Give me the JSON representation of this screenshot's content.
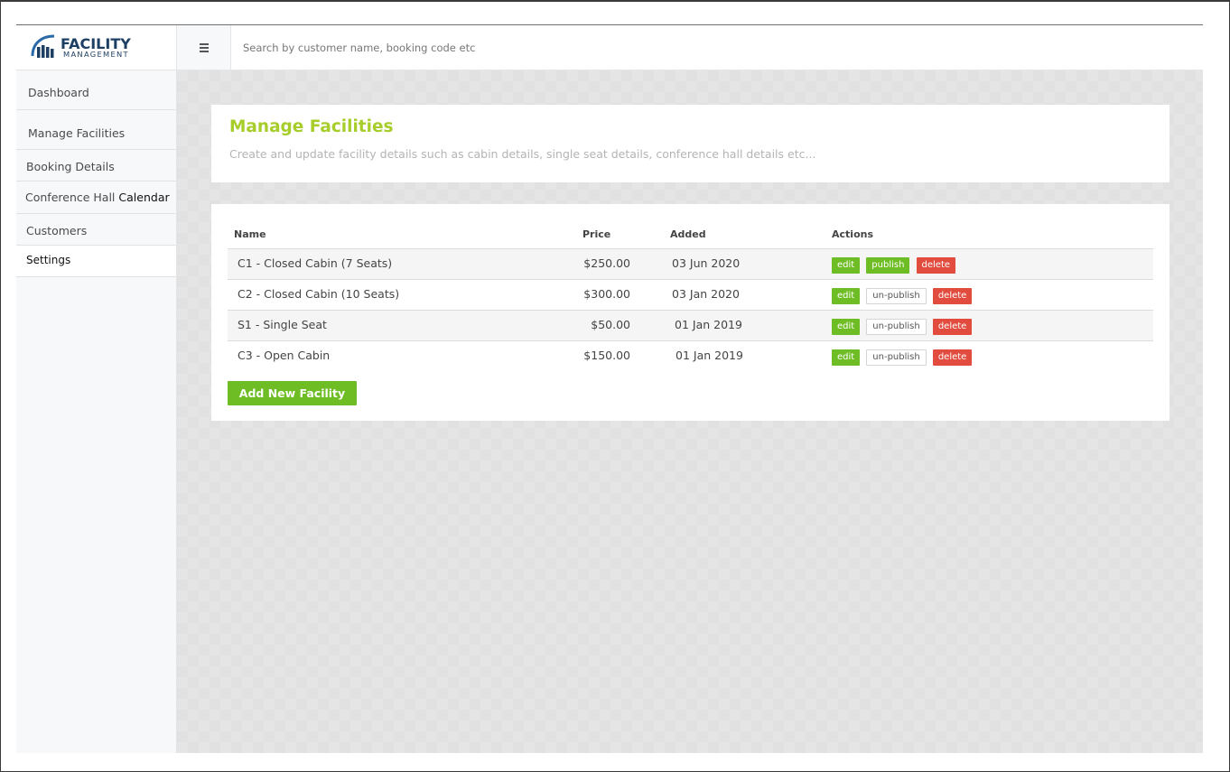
{
  "brand": {
    "name_top": "FACILITY",
    "name_bottom": "MANAGEMENT"
  },
  "search": {
    "placeholder": "Search by customer name, booking code etc"
  },
  "sidebar": {
    "items": [
      {
        "label": "Dashboard"
      },
      {
        "label": "Manage Facilities"
      },
      {
        "label": "Booking Details"
      },
      {
        "label_a": "Conference Hall",
        "label_b": "Calendar"
      },
      {
        "label": "Customers"
      },
      {
        "label": "Settings"
      }
    ]
  },
  "page": {
    "title": "Manage Facilities",
    "subtitle": "Create and update facility details such as cabin details, single seat details, conference hall details etc..."
  },
  "table": {
    "headers": {
      "name": "Name",
      "price": "Price",
      "added": "Added",
      "actions": "Actions"
    },
    "rows": [
      {
        "name": "C1 - Closed Cabin (7 Seats)",
        "price": "$250.00",
        "added": "03 Jun 2020",
        "edit": "edit",
        "publish": "publish",
        "delete": "delete"
      },
      {
        "name": "C2 - Closed Cabin (10 Seats)",
        "price": "$300.00",
        "added": "03 Jan 2020",
        "edit": "edit",
        "publish": "un-publish",
        "delete": "delete"
      },
      {
        "name": "S1 - Single Seat",
        "price": "$50.00",
        "added": "01 Jan 2019",
        "edit": "edit",
        "publish": "un-publish",
        "delete": "delete"
      },
      {
        "name": "C3 - Open Cabin",
        "price": "$150.00",
        "added": "01 Jan 2019",
        "edit": "edit",
        "publish": "un-publish",
        "delete": "delete"
      }
    ]
  },
  "actions": {
    "add_label": "Add New Facility"
  },
  "colors": {
    "brand_blue": "#1d3f63",
    "title_green": "#a6cd2a",
    "button_green": "#6ebd25",
    "button_red": "#e24c3f"
  }
}
